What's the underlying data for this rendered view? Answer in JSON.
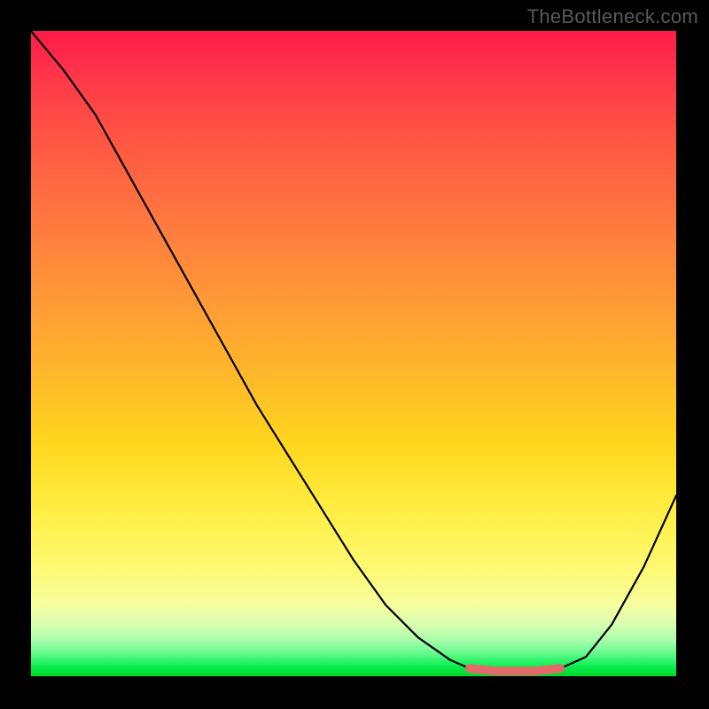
{
  "watermark": "TheBottleneck.com",
  "chart_data": {
    "type": "line",
    "title": "",
    "xlabel": "",
    "ylabel": "",
    "xlim": [
      0,
      100
    ],
    "ylim": [
      0,
      100
    ],
    "series": [
      {
        "name": "bottleneck-curve",
        "x": [
          0,
          5,
          10,
          15,
          20,
          25,
          30,
          35,
          40,
          45,
          50,
          55,
          60,
          65,
          68,
          72,
          78,
          82,
          86,
          90,
          95,
          100
        ],
        "y": [
          100,
          94,
          87,
          78,
          69,
          60,
          51,
          42,
          34,
          26,
          18,
          11,
          6,
          2.5,
          1.2,
          0.8,
          0.8,
          1.2,
          3,
          8,
          17,
          28
        ]
      },
      {
        "name": "highlight-band",
        "x": [
          68,
          72,
          78,
          82
        ],
        "y": [
          1.2,
          0.8,
          0.8,
          1.2
        ]
      }
    ],
    "gradient_stops": [
      {
        "pct": 0,
        "color": "#ff1a49"
      },
      {
        "pct": 50,
        "color": "#ffc024"
      },
      {
        "pct": 85,
        "color": "#fafc88"
      },
      {
        "pct": 100,
        "color": "#00d82a"
      }
    ]
  }
}
